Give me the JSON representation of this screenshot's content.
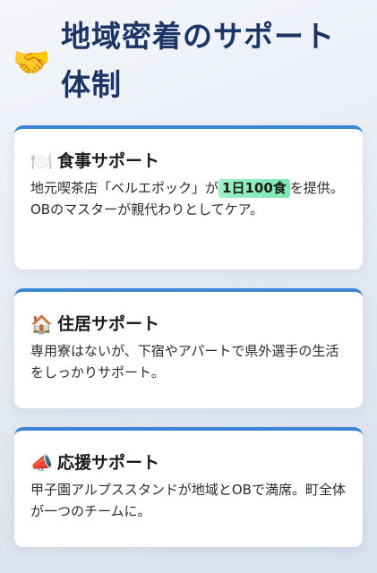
{
  "header": {
    "icon": "handshake-icon",
    "icon_glyph": "🤝",
    "title_line1": "地域密着のサポート",
    "title_line2": "体制"
  },
  "cards": [
    {
      "icon": "plate-cutlery-icon",
      "icon_glyph": "🍽️",
      "title": "食事サポート",
      "text_before": "地元喫茶店「ベルエポック」が",
      "highlight": "1日100食",
      "text_after": "を提供。OBのマスターが親代わりとしてケア。"
    },
    {
      "icon": "house-icon",
      "icon_glyph": "🏠",
      "title": "住居サポート",
      "text": "専用寮はないが、下宿やアパートで県外選手の生活をしっかりサポート。"
    },
    {
      "icon": "megaphone-icon",
      "icon_glyph": "📣",
      "title": "応援サポート",
      "text": "甲子園アルプススタンドが地域とOBで満席。町全体が一つのチームに。"
    }
  ],
  "colors": {
    "title": "#1c3566",
    "card_accent": "#3a86d4",
    "highlight": "#8eedbf"
  }
}
